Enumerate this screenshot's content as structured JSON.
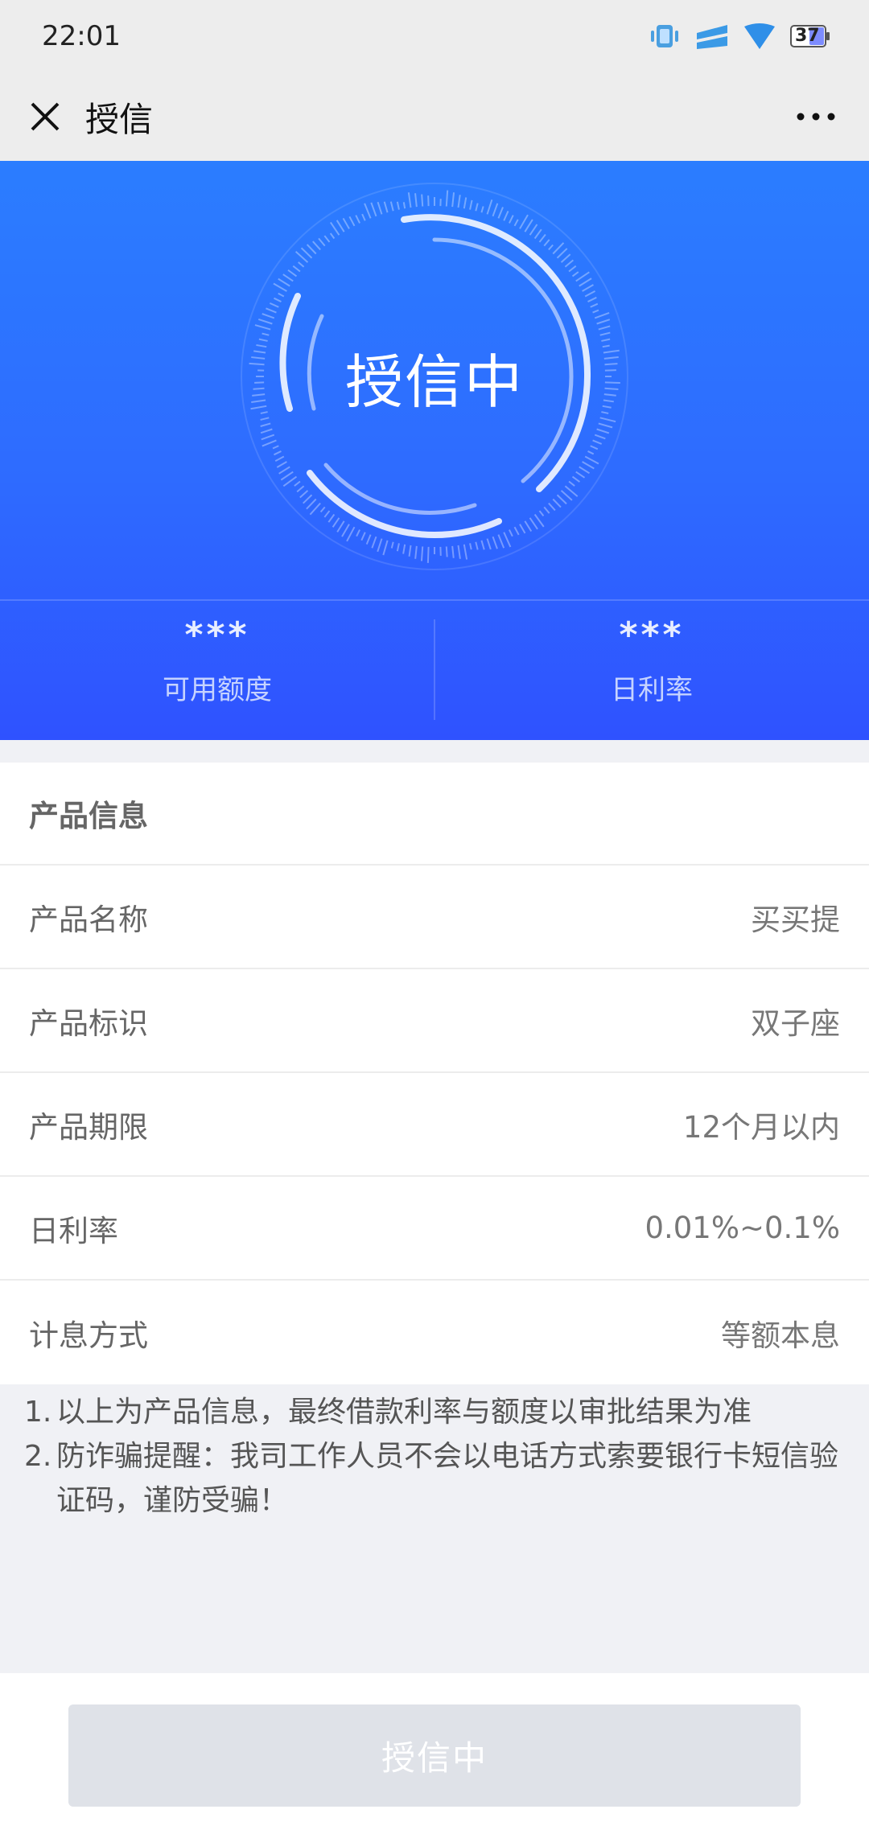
{
  "status_bar": {
    "time": "22:01",
    "battery": "37"
  },
  "nav": {
    "title": "授信"
  },
  "hero": {
    "ring_text": "授信中",
    "stats": [
      {
        "value": "***",
        "label": "可用额度"
      },
      {
        "value": "***",
        "label": "日利率"
      }
    ]
  },
  "product": {
    "header": "产品信息",
    "rows": [
      {
        "label": "产品名称",
        "value": "买买提"
      },
      {
        "label": "产品标识",
        "value": "双子座"
      },
      {
        "label": "产品期限",
        "value": "12个月以内"
      },
      {
        "label": "日利率",
        "value": "0.01%~0.1%"
      },
      {
        "label": "计息方式",
        "value": "等额本息"
      }
    ]
  },
  "notes": [
    {
      "num": "1.",
      "text": "以上为产品信息，最终借款利率与额度以审批结果为准"
    },
    {
      "num": "2.",
      "text": "防诈骗提醒：我司工作人员不会以电话方式索要银行卡短信验证码，谨防受骗！"
    }
  ],
  "button": {
    "label": "授信中"
  }
}
